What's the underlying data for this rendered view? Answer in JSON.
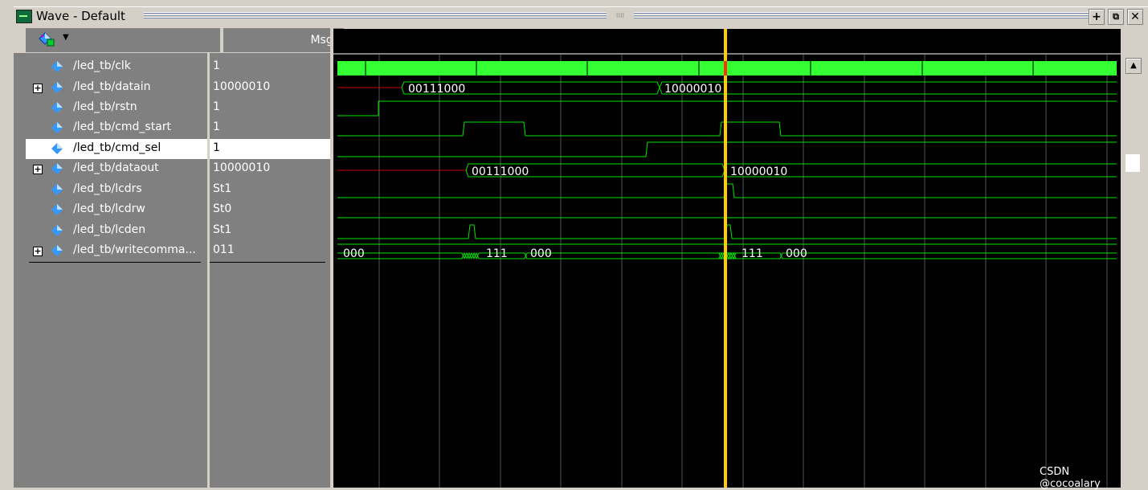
{
  "window": {
    "title": "Wave - Default"
  },
  "header": {
    "msgs_label": "Msgs"
  },
  "signals": [
    {
      "name": "/led_tb/clk",
      "value": "1",
      "expandable": false
    },
    {
      "name": "/led_tb/datain",
      "value": "10000010",
      "expandable": true
    },
    {
      "name": "/led_tb/rstn",
      "value": "1",
      "expandable": false
    },
    {
      "name": "/led_tb/cmd_start",
      "value": "1",
      "expandable": false
    },
    {
      "name": "/led_tb/cmd_sel",
      "value": "1",
      "expandable": false
    },
    {
      "name": "/led_tb/dataout",
      "value": "10000010",
      "expandable": true
    },
    {
      "name": "/led_tb/lcdrs",
      "value": "St1",
      "expandable": false
    },
    {
      "name": "/led_tb/lcdrw",
      "value": "St0",
      "expandable": false
    },
    {
      "name": "/led_tb/lcden",
      "value": "St1",
      "expandable": false
    },
    {
      "name": "/led_tb/writecomma...",
      "value": "011",
      "expandable": true
    }
  ],
  "wave_labels": {
    "datain_1": "00111000",
    "datain_2": "10000010",
    "dataout_1": "00111000",
    "dataout_2": "10000010",
    "writecmd_0": "000",
    "writecmd_1": "111",
    "writecmd_2": "000",
    "writecmd_3": "111",
    "writecmd_4": "000"
  },
  "colors": {
    "wave": "#00e600",
    "cursor": "#ffcc00",
    "undefined": "#cc0000",
    "clk_fill": "#33ff33"
  },
  "watermark": "CSDN @cocoalary"
}
